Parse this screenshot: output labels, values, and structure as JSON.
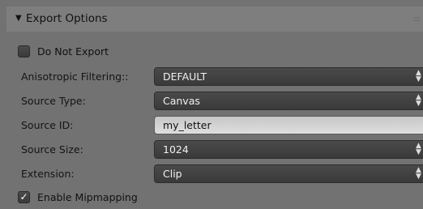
{
  "panel": {
    "title": "Export Options",
    "collapse_arrow": "▼",
    "grip": "::::"
  },
  "do_not_export": {
    "label": "Do Not Export",
    "checked": false
  },
  "anisotropic": {
    "label": "Anisotropic Filtering::",
    "value": "DEFAULT"
  },
  "source_type": {
    "label": "Source Type:",
    "value": "Canvas"
  },
  "source_id": {
    "label": "Source ID:",
    "value": "my_letter"
  },
  "source_size": {
    "label": "Source Size:",
    "value": "1024"
  },
  "extension": {
    "label": "Extension:",
    "value": "Clip"
  },
  "mipmapping": {
    "label": "Enable Mipmapping",
    "checked": true,
    "check_glyph": "✓"
  },
  "icons": {
    "spinner": "up-down-spinner-icon",
    "checkbox": "checkbox-icon"
  }
}
